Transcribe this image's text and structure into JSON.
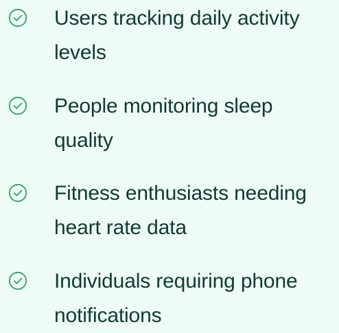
{
  "list": {
    "items": [
      {
        "icon": "check-circle-icon",
        "label": "Users tracking daily activity levels"
      },
      {
        "icon": "check-circle-icon",
        "label": "People monitoring sleep quality"
      },
      {
        "icon": "check-circle-icon",
        "label": "Fitness enthusiasts needing heart rate data"
      },
      {
        "icon": "check-circle-icon",
        "label": "Individuals requiring phone notifications"
      }
    ]
  },
  "colors": {
    "background": "#effbf5",
    "text": "#0e3b34",
    "icon": "#2f9e74"
  }
}
